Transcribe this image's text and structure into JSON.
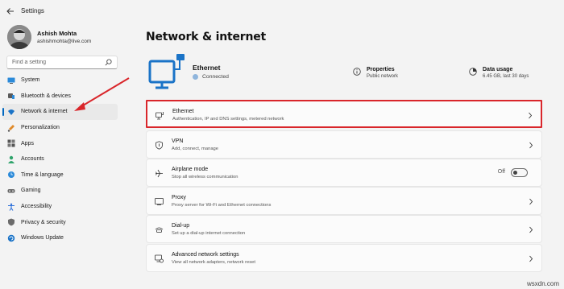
{
  "app": {
    "title": "Settings"
  },
  "profile": {
    "name": "Ashish Mohta",
    "email": "ashishmohta@live.com"
  },
  "search": {
    "placeholder": "Find a setting"
  },
  "sidebar": {
    "items": [
      {
        "label": "System",
        "icon": "monitor-icon"
      },
      {
        "label": "Bluetooth & devices",
        "icon": "bluetooth-icon"
      },
      {
        "label": "Network & internet",
        "icon": "wifi-icon",
        "active": true
      },
      {
        "label": "Personalization",
        "icon": "brush-icon"
      },
      {
        "label": "Apps",
        "icon": "apps-icon"
      },
      {
        "label": "Accounts",
        "icon": "person-icon"
      },
      {
        "label": "Time & language",
        "icon": "globe-clock-icon"
      },
      {
        "label": "Gaming",
        "icon": "gamepad-icon"
      },
      {
        "label": "Accessibility",
        "icon": "accessibility-icon"
      },
      {
        "label": "Privacy & security",
        "icon": "shield-icon"
      },
      {
        "label": "Windows Update",
        "icon": "update-icon"
      }
    ]
  },
  "main": {
    "title": "Network & internet",
    "hero": {
      "title": "Ethernet",
      "status": "Connected",
      "properties": {
        "title": "Properties",
        "sub": "Public network"
      },
      "data_usage": {
        "title": "Data usage",
        "sub": "6.45 GB, last 30 days"
      }
    },
    "cards": [
      {
        "title": "Ethernet",
        "sub": "Authentication, IP and DNS settings, metered network",
        "icon": "ethernet-icon"
      },
      {
        "title": "VPN",
        "sub": "Add, connect, manage",
        "icon": "vpn-shield-icon"
      },
      {
        "title": "Airplane mode",
        "sub": "Stop all wireless communication",
        "icon": "airplane-icon",
        "toggle_label": "Off",
        "toggle_on": false
      },
      {
        "title": "Proxy",
        "sub": "Proxy server for Wi-Fi and Ethernet connections",
        "icon": "proxy-icon"
      },
      {
        "title": "Dial-up",
        "sub": "Set up a dial-up internet connection",
        "icon": "dialup-icon"
      },
      {
        "title": "Advanced network settings",
        "sub": "View all network adapters, network reset",
        "icon": "advanced-network-icon"
      }
    ]
  },
  "colors": {
    "accent": "#0067c0",
    "highlight": "#d9262b",
    "background": "#f3f3f3"
  },
  "watermark": "wsxdn.com"
}
